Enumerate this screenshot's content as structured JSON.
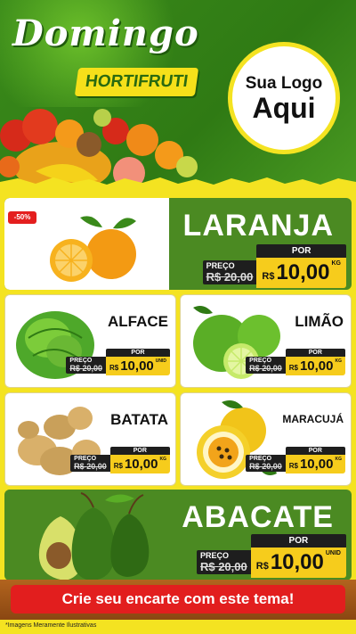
{
  "header": {
    "title": "Domingo",
    "subtitle": "HORTIFRUTI",
    "logo_line1": "Sua Logo",
    "logo_line2": "Aqui"
  },
  "colors": {
    "green": "#4b8a22",
    "yellow": "#f4e321",
    "red": "#e21e1e",
    "price_yellow": "#f6cc1c"
  },
  "discount_badge": "-50%",
  "products": {
    "laranja": {
      "name": "LARANJA",
      "preco_label": "PREÇO",
      "old_currency": "R$",
      "old_price": "20,00",
      "por_label": "POR",
      "currency": "R$",
      "price": "10,00",
      "unit": "KG",
      "icon": "orange-icon"
    },
    "alface": {
      "name": "ALFACE",
      "preco_label": "PREÇO",
      "old_currency": "R$",
      "old_price": "20,00",
      "por_label": "POR",
      "currency": "R$",
      "price": "10,00",
      "unit": "UNID",
      "icon": "lettuce-icon"
    },
    "limao": {
      "name": "LIMÃO",
      "preco_label": "PREÇO",
      "old_currency": "R$",
      "old_price": "20,00",
      "por_label": "POR",
      "currency": "R$",
      "price": "10,00",
      "unit": "KG",
      "icon": "lime-icon"
    },
    "batata": {
      "name": "BATATA",
      "preco_label": "PREÇO",
      "old_currency": "R$",
      "old_price": "20,00",
      "por_label": "POR",
      "currency": "R$",
      "price": "10,00",
      "unit": "KG",
      "icon": "potato-icon"
    },
    "maracuja": {
      "name": "MARACUJÁ",
      "preco_label": "PREÇO",
      "old_currency": "R$",
      "old_price": "20,00",
      "por_label": "POR",
      "currency": "R$",
      "price": "10,00",
      "unit": "KG",
      "icon": "passion-fruit-icon"
    },
    "abacate": {
      "name": "ABACATE",
      "preco_label": "PREÇO",
      "old_currency": "R$",
      "old_price": "20,00",
      "por_label": "POR",
      "currency": "R$",
      "price": "10,00",
      "unit": "UNID",
      "icon": "avocado-icon"
    }
  },
  "cta": "Crie seu encarte com este tema!",
  "footer": "*Imagens Meramente Ilustrativas"
}
